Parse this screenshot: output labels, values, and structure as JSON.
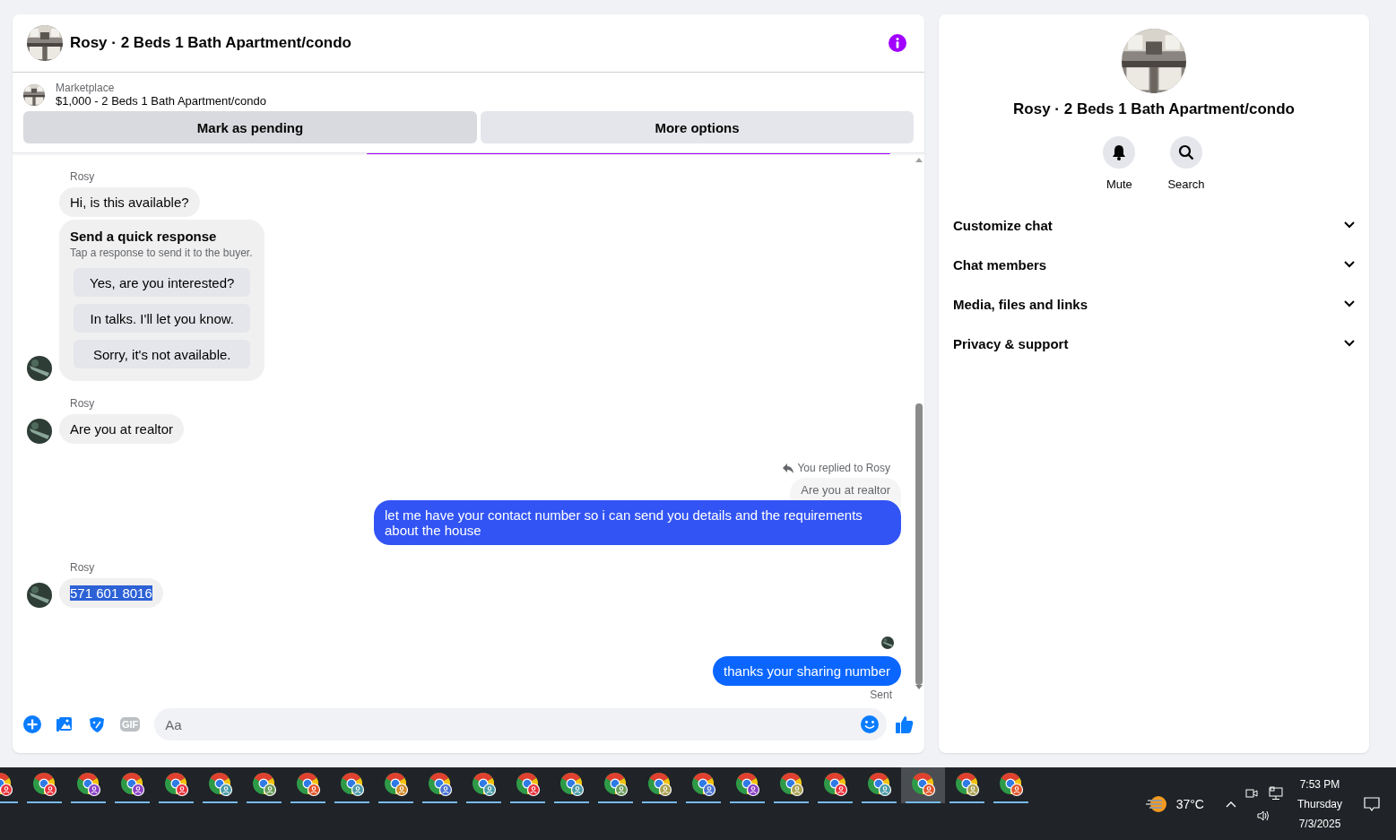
{
  "chat": {
    "title": "Rosy · 2 Beds 1 Bath Apartment/condo",
    "listing": {
      "source": "Marketplace",
      "description": "$1,000 - 2 Beds 1 Bath Apartment/condo",
      "actions": [
        "Mark as pending",
        "More options"
      ]
    },
    "messages": [
      {
        "kind": "incoming",
        "sender": "Rosy",
        "items": [
          {
            "kind": "text",
            "text": "Hi, is this available?",
            "highlighted": false
          },
          {
            "kind": "quick_responses",
            "title": "Send a quick response",
            "subtitle": "Tap a response to send it to the buyer.",
            "options": [
              "Yes, are you interested?",
              "In talks. I'll let you know.",
              "Sorry, it's not available."
            ]
          }
        ]
      },
      {
        "kind": "incoming",
        "sender": "Rosy",
        "items": [
          {
            "kind": "text",
            "text": "Are you at realtor",
            "highlighted": false
          }
        ]
      },
      {
        "kind": "outgoing",
        "reply_label": "You replied to Rosy",
        "reply_quote": "Are you at realtor",
        "text": "let me have your contact number so i can send you details and the requirements about the house",
        "color": "#3254f4"
      },
      {
        "kind": "incoming",
        "sender": "Rosy",
        "items": [
          {
            "kind": "text",
            "text": "571 601 8016",
            "highlighted": true
          }
        ]
      },
      {
        "kind": "outgoing",
        "seen": true,
        "text": "thanks your sharing number",
        "status": "Sent",
        "color": "#0a66ff"
      }
    ],
    "composer": {
      "gif_label": "GIF",
      "placeholder": "Aa"
    }
  },
  "details": {
    "title": "Rosy · 2 Beds 1 Bath Apartment/condo",
    "actions": [
      "Mute",
      "Search"
    ],
    "sections": [
      {
        "label": "Customize chat",
        "expanded": false
      },
      {
        "label": "Chat members",
        "expanded": false
      },
      {
        "label": "Media, files and links",
        "expanded": false
      },
      {
        "label": "Privacy & support",
        "expanded": false
      }
    ]
  },
  "taskbar": {
    "apps": [
      {
        "color": "#e8303a",
        "selected": false
      },
      {
        "color": "#e8303a",
        "selected": false
      },
      {
        "color": "#8a3fc4",
        "selected": false
      },
      {
        "color": "#8a3fc4",
        "selected": false
      },
      {
        "color": "#e8303a",
        "selected": false
      },
      {
        "color": "#4a9aa6",
        "selected": false
      },
      {
        "color": "#6a9a5a",
        "selected": false
      },
      {
        "color": "#e0542a",
        "selected": false
      },
      {
        "color": "#4a9aa6",
        "selected": false
      },
      {
        "color": "#d08a2a",
        "selected": false
      },
      {
        "color": "#4a72d0",
        "selected": false
      },
      {
        "color": "#4a9aa6",
        "selected": false
      },
      {
        "color": "#e8303a",
        "selected": false
      },
      {
        "color": "#4a9aa6",
        "selected": false
      },
      {
        "color": "#6a9a5a",
        "selected": false
      },
      {
        "color": "#a8a050",
        "selected": false
      },
      {
        "color": "#4a72d0",
        "selected": false
      },
      {
        "color": "#8a3fc4",
        "selected": false
      },
      {
        "color": "#a8a050",
        "selected": false
      },
      {
        "color": "#e8303a",
        "selected": false
      },
      {
        "color": "#4a9aa6",
        "selected": false
      },
      {
        "color": "#e0542a",
        "selected": true
      },
      {
        "color": "#a8a050",
        "selected": false
      },
      {
        "color": "#e0542a",
        "selected": false
      }
    ],
    "temperature": "37°C",
    "time": "7:53 PM",
    "day": "Thursday",
    "date": "7/3/2025"
  }
}
